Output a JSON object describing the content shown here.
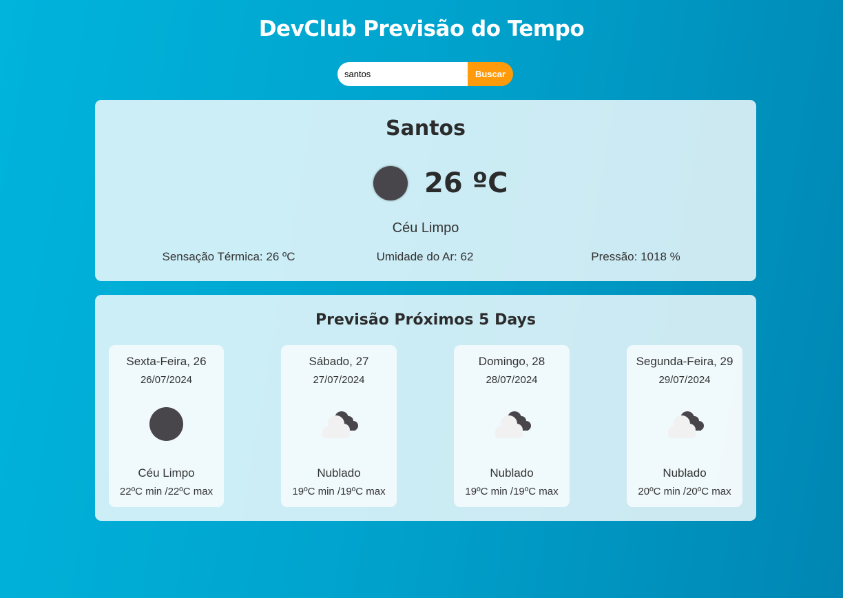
{
  "header": {
    "title": "DevClub Previsão do Tempo"
  },
  "search": {
    "value": "santos",
    "button_label": "Buscar"
  },
  "current": {
    "city": "Santos",
    "icon": "clear-sky-icon",
    "temperature": "26 ºC",
    "condition": "Céu Limpo",
    "feels_like": "Sensação Térmica: 26 ºC",
    "humidity": "Umidade do Ar: 62",
    "pressure": "Pressão: 1018 %"
  },
  "forecast": {
    "title": "Previsão Próximos 5 Days",
    "days": [
      {
        "name": "Sexta-Feira, 26",
        "date": "26/07/2024",
        "icon": "clear-sky-icon",
        "condition": "Céu Limpo",
        "temps": "22ºC min /22ºC max"
      },
      {
        "name": "Sábado, 27",
        "date": "27/07/2024",
        "icon": "cloudy-icon",
        "condition": "Nublado",
        "temps": "19ºC min /19ºC max"
      },
      {
        "name": "Domingo, 28",
        "date": "28/07/2024",
        "icon": "cloudy-icon",
        "condition": "Nublado",
        "temps": "19ºC min /19ºC max"
      },
      {
        "name": "Segunda-Feira, 29",
        "date": "29/07/2024",
        "icon": "cloudy-icon",
        "condition": "Nublado",
        "temps": "20ºC min /20ºC max"
      }
    ]
  },
  "colors": {
    "accent_button": "#ff9a0a",
    "background_start": "#00b4dc",
    "background_end": "#0086b3"
  }
}
